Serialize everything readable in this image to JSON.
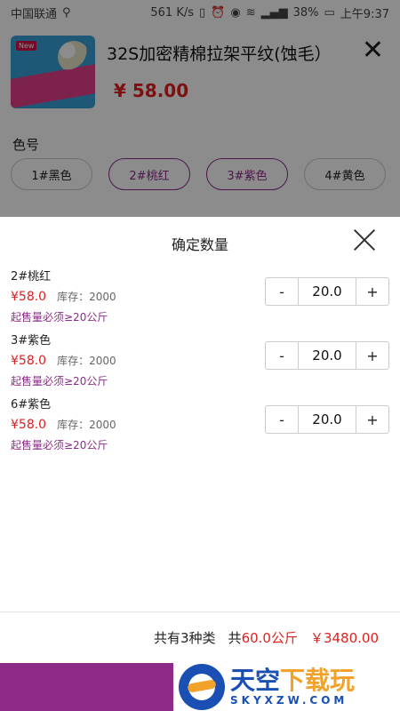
{
  "status": {
    "carrier": "中国联通",
    "speed": "561 K/s",
    "battery": "38%",
    "time": "上午9:37"
  },
  "product": {
    "badge": "New",
    "title": "32S加密精棉拉架平纹(蚀毛）",
    "price": "¥ 58.00",
    "color_label": "色号",
    "chips": [
      {
        "label": "1#黑色",
        "selected": false
      },
      {
        "label": "2#桃红",
        "selected": true
      },
      {
        "label": "3#紫色",
        "selected": true
      },
      {
        "label": "4#黄色",
        "selected": false
      }
    ]
  },
  "sheet": {
    "title": "确定数量",
    "items": [
      {
        "name": "2#桃红",
        "price": "¥58.0",
        "stock": "库存：2000",
        "min": "起售量必须≥20公斤",
        "minus": "-",
        "qty": "20.0",
        "plus": "+"
      },
      {
        "name": "3#紫色",
        "price": "¥58.0",
        "stock": "库存：2000",
        "min": "起售量必须≥20公斤",
        "minus": "-",
        "qty": "20.0",
        "plus": "+"
      },
      {
        "name": "6#紫色",
        "price": "¥58.0",
        "stock": "库存：2000",
        "min": "起售量必须≥20公斤",
        "minus": "-",
        "qty": "20.0",
        "plus": "+"
      }
    ]
  },
  "footer": {
    "kinds": "共有3种类",
    "total_prefix": "共",
    "total_weight": "60.0公斤",
    "total_price": "￥3480.00"
  },
  "watermark": {
    "main_blue": "天空",
    "main_orange": "下载玩",
    "sub": "SKYXZW.COM"
  },
  "colors": {
    "accent": "#8e2a87",
    "price": "#e01f1f"
  }
}
